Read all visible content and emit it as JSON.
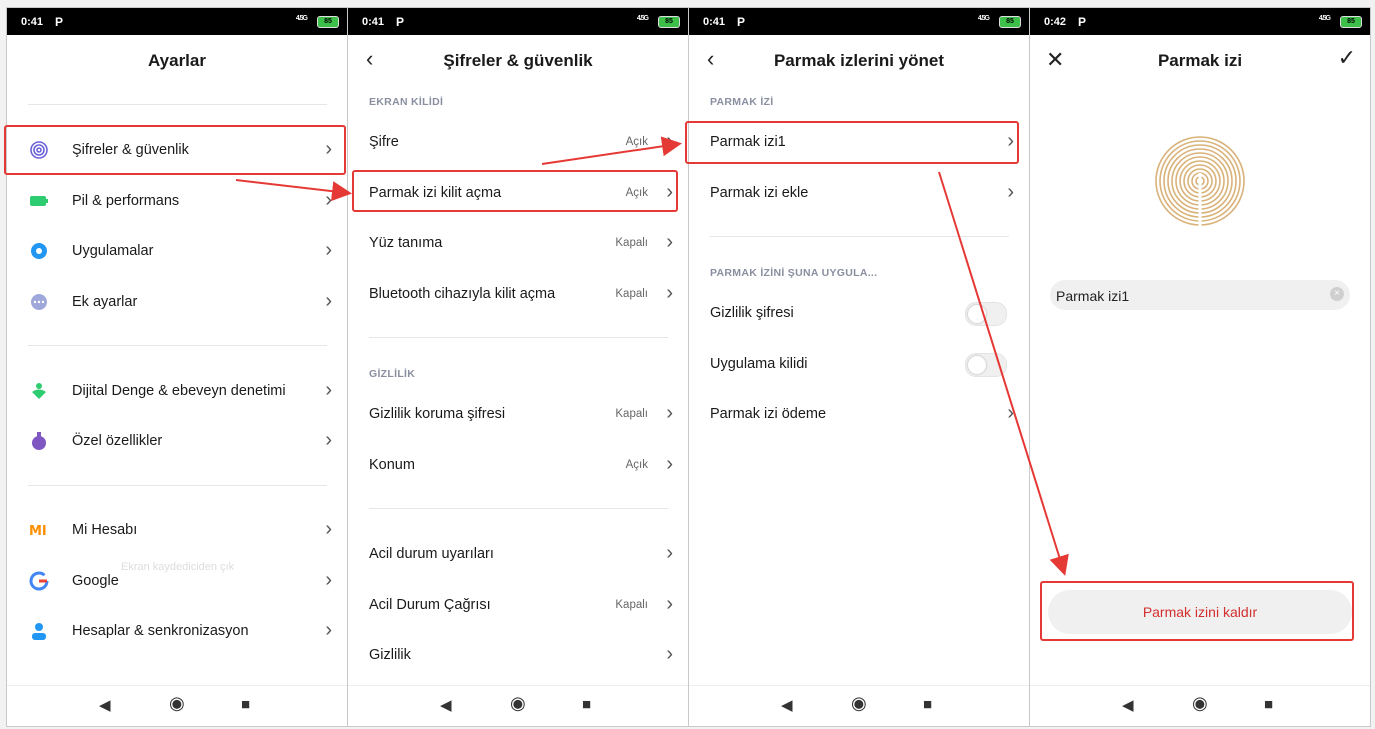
{
  "status_bars": [
    {
      "time": "0:41",
      "carrier": "P",
      "signal": "4.5G",
      "battery": "85"
    },
    {
      "time": "0:41",
      "carrier": "P",
      "signal": "4.5G",
      "battery": "85"
    },
    {
      "time": "0:41",
      "carrier": "P",
      "signal": "4.5G",
      "battery": "85"
    },
    {
      "time": "0:42",
      "carrier": "P",
      "signal": "4.5G",
      "battery": "85"
    }
  ],
  "screen1": {
    "title": "Ayarlar",
    "items": [
      {
        "label": "Şifreler & güvenlik",
        "icon": "fingerprint-icon"
      },
      {
        "label": "Pil & performans",
        "icon": "battery-icon"
      },
      {
        "label": "Uygulamalar",
        "icon": "gear-icon"
      },
      {
        "label": "Ek ayarlar",
        "icon": "more-icon"
      },
      {
        "label": "Dijital Denge & ebeveyn denetimi",
        "icon": "person-heart-icon"
      },
      {
        "label": "Özel özellikler",
        "icon": "potion-icon"
      },
      {
        "label": "Mi Hesabı",
        "icon": "mi-logo-icon"
      },
      {
        "label": "Google",
        "icon": "google-icon"
      },
      {
        "label": "Hesaplar & senkronizasyon",
        "icon": "account-icon"
      }
    ],
    "ghost_text": "Ekran kaydediciden çık"
  },
  "screen2": {
    "title": "Şifreler & güvenlik",
    "section1": "EKRAN KİLİDİ",
    "section2": "GİZLİLİK",
    "items": [
      {
        "label": "Şifre",
        "value": "Açık"
      },
      {
        "label": "Parmak izi kilit açma",
        "value": "Açık"
      },
      {
        "label": "Yüz tanıma",
        "value": "Kapalı"
      },
      {
        "label": "Bluetooth cihazıyla kilit açma",
        "value": "Kapalı"
      },
      {
        "label": "Gizlilik koruma şifresi",
        "value": "Kapalı"
      },
      {
        "label": "Konum",
        "value": "Açık"
      },
      {
        "label": "Acil durum uyarıları",
        "value": ""
      },
      {
        "label": "Acil Durum Çağrısı",
        "value": "Kapalı"
      },
      {
        "label": "Gizlilik",
        "value": ""
      }
    ]
  },
  "screen3": {
    "title": "Parmak izlerini yönet",
    "section1": "PARMAK İZİ",
    "section2": "PARMAK İZİNİ ŞUNA UYGULA...",
    "items": [
      {
        "label": "Parmak izi1"
      },
      {
        "label": "Parmak izi ekle"
      },
      {
        "label": "Gizlilik şifresi",
        "toggle": false
      },
      {
        "label": "Uygulama kilidi",
        "toggle": false
      },
      {
        "label": "Parmak izi ödeme"
      }
    ]
  },
  "screen4": {
    "title": "Parmak izi",
    "fingerprint_name": "Parmak izi1",
    "remove_button": "Parmak izini kaldır"
  },
  "colors": {
    "highlight": "#e53935",
    "remove_text": "#d32f2f",
    "fingerprint": "#d9b27a"
  }
}
